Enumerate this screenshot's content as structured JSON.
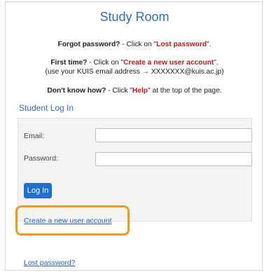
{
  "page": {
    "title": "Study Room"
  },
  "instructions": {
    "forgot_prefix": "Forgot password?",
    "forgot_mid": " - Click on \"",
    "forgot_link": "Lost password",
    "forgot_suffix": "\".",
    "first_prefix": "First time?",
    "first_mid": " - Click on \"",
    "first_link": "Create a new user account",
    "first_suffix": "\".",
    "email_hint": "(use your KUIS email address → XXXXXXX@kuis.ac.jp)",
    "help_prefix": "Don't know how?",
    "help_mid": " - Click \"",
    "help_link": "Help",
    "help_suffix": "\" at the top of the page."
  },
  "login": {
    "section_title": "Student Log In",
    "email_label": "Email:",
    "email_value": "",
    "password_label": "Password:",
    "password_value": "",
    "login_button": "Log In",
    "create_account_link": "Create a new user account",
    "lost_password_link": "Lost password?"
  },
  "colors": {
    "accent": "#2e6fb7",
    "button": "#1f6fd0",
    "highlight": "#f39a1d",
    "emphasis_red": "#c0161b"
  }
}
